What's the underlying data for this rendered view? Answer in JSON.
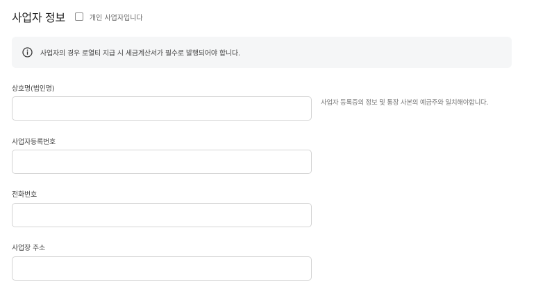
{
  "section": {
    "title": "사업자 정보",
    "individual_checkbox_label": "개인 사업자입니다",
    "individual_checked": false
  },
  "notice": {
    "icon": "info-icon",
    "text": "사업자의 경우 로열티 지급 시 세금계산서가 필수로 발행되어야 합니다."
  },
  "fields": {
    "company_name": {
      "label": "상호명(법인명)",
      "value": "",
      "helper": "사업자 등록증의 정보 및 통장 사본의 예금주와 일치해야합니다."
    },
    "business_number": {
      "label": "사업자등록번호",
      "value": ""
    },
    "phone": {
      "label": "전화번호",
      "value": ""
    },
    "address": {
      "label": "사업장 주소",
      "value": ""
    }
  }
}
